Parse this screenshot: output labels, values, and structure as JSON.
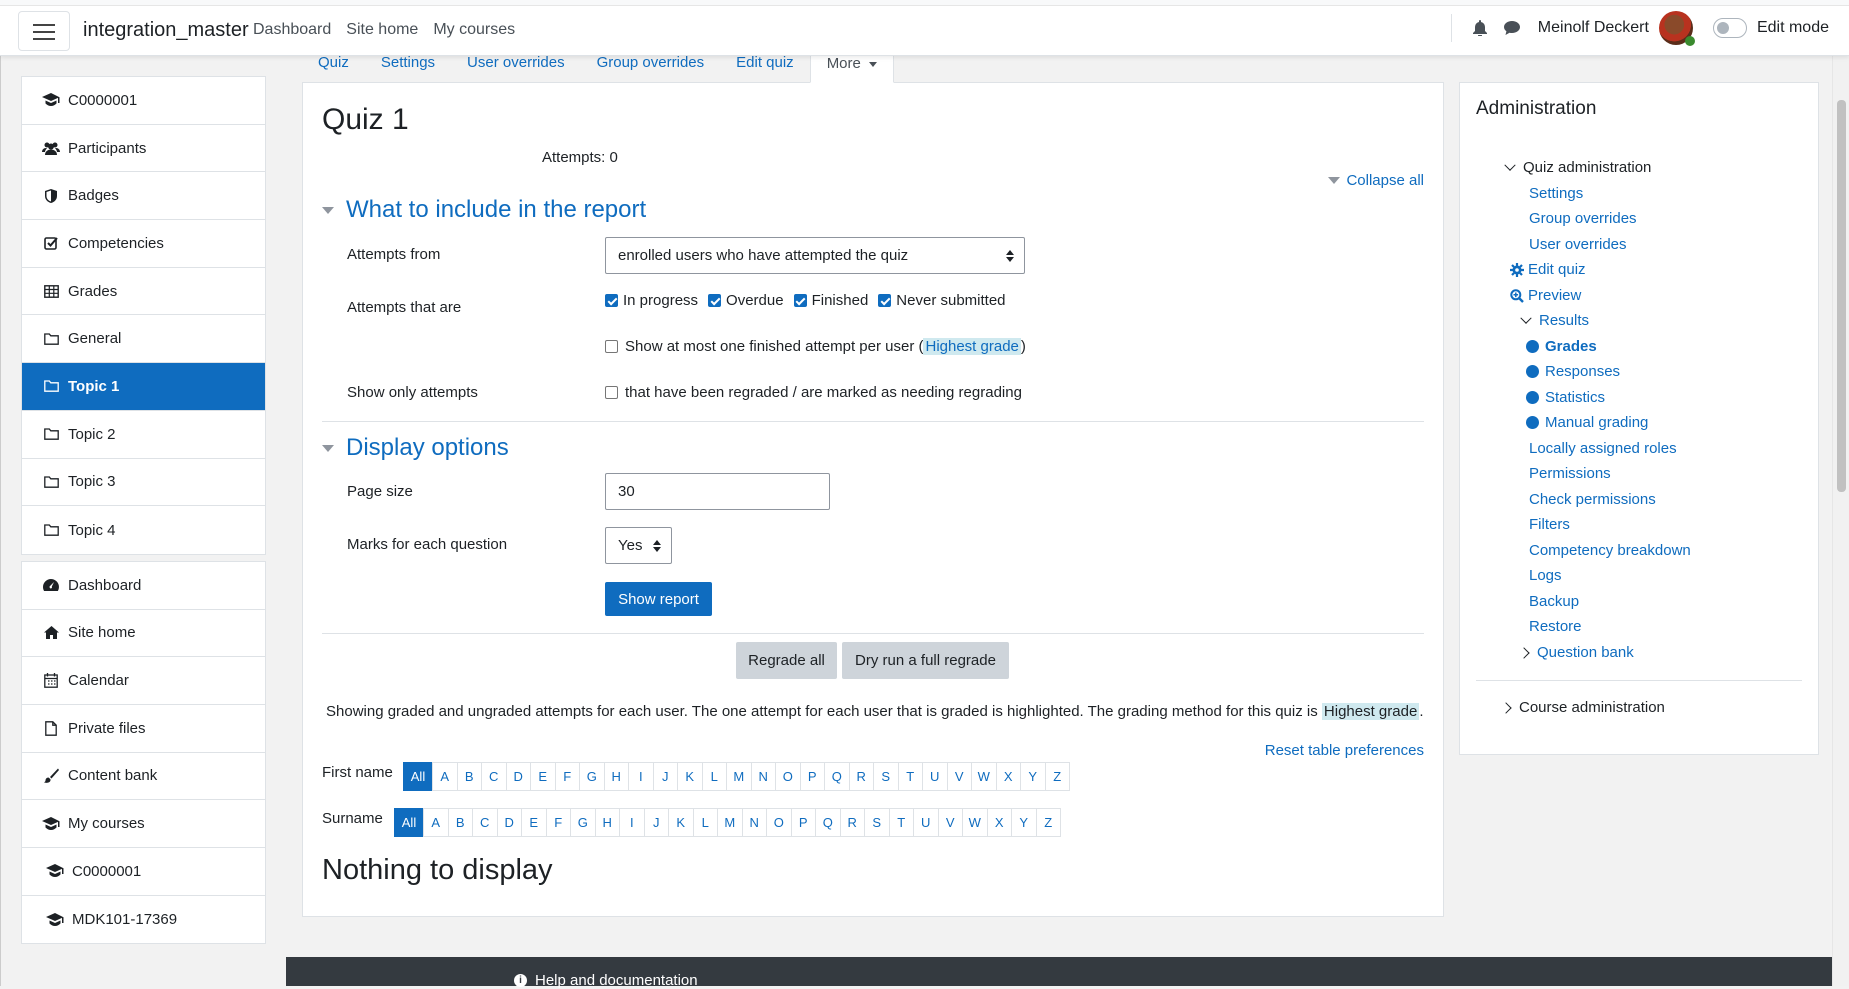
{
  "navbar": {
    "brand": "integration_master",
    "links": [
      "Dashboard",
      "Site home",
      "My courses"
    ],
    "username": "Meinolf Deckert",
    "edit_mode_label": "Edit mode"
  },
  "drawer": {
    "course_items": [
      {
        "label": "C0000001",
        "icon": "graduation-cap-icon"
      },
      {
        "label": "Participants",
        "icon": "users-icon"
      },
      {
        "label": "Badges",
        "icon": "shield-icon"
      },
      {
        "label": "Competencies",
        "icon": "check-square-icon"
      },
      {
        "label": "Grades",
        "icon": "table-icon"
      },
      {
        "label": "General",
        "icon": "folder-icon"
      },
      {
        "label": "Topic 1",
        "icon": "folder-icon",
        "active": true
      },
      {
        "label": "Topic 2",
        "icon": "folder-icon"
      },
      {
        "label": "Topic 3",
        "icon": "folder-icon"
      },
      {
        "label": "Topic 4",
        "icon": "folder-icon"
      }
    ],
    "site_items": [
      {
        "label": "Dashboard",
        "icon": "dashboard-icon"
      },
      {
        "label": "Site home",
        "icon": "home-icon"
      },
      {
        "label": "Calendar",
        "icon": "calendar-icon"
      },
      {
        "label": "Private files",
        "icon": "file-icon"
      },
      {
        "label": "Content bank",
        "icon": "brush-icon"
      },
      {
        "label": "My courses",
        "icon": "graduation-cap-icon"
      },
      {
        "label": "C0000001",
        "icon": "graduation-cap-icon",
        "indent": true
      },
      {
        "label": "MDK101-17369",
        "icon": "graduation-cap-icon",
        "indent": true
      }
    ]
  },
  "tabs": [
    "Quiz",
    "Settings",
    "User overrides",
    "Group overrides",
    "Edit quiz",
    "More"
  ],
  "page": {
    "title": "Quiz 1",
    "attempts": "Attempts: 0",
    "collapse_all": "Collapse all"
  },
  "report_section": {
    "heading": "What to include in the report",
    "attempts_from_label": "Attempts from",
    "attempts_from_value": "enrolled users who have attempted the quiz",
    "attempts_that_are_label": "Attempts that are",
    "states": [
      {
        "label": "In progress",
        "checked": true
      },
      {
        "label": "Overdue",
        "checked": true
      },
      {
        "label": "Finished",
        "checked": true
      },
      {
        "label": "Never submitted",
        "checked": true
      }
    ],
    "one_attempt_text": "Show at most one finished attempt per user (",
    "one_attempt_highlight": "Highest grade",
    "one_attempt_close": ")",
    "show_only_label": "Show only attempts",
    "regraded_text": "that have been regraded / are marked as needing regrading"
  },
  "display_section": {
    "heading": "Display options",
    "page_size_label": "Page size",
    "page_size_value": "30",
    "marks_label": "Marks for each question",
    "marks_value": "Yes",
    "show_report": "Show report"
  },
  "regrade": {
    "regrade_all": "Regrade all",
    "dry_run": "Dry run a full regrade"
  },
  "info": {
    "text": "Showing graded and ungraded attempts for each user. The one attempt for each user that is graded is highlighted. The grading method for this quiz is ",
    "method": "Highest grade",
    "end": "."
  },
  "reset_table": "Reset table preferences",
  "initials": {
    "first_name_label": "First name",
    "surname_label": "Surname",
    "all": "All",
    "letters": [
      "A",
      "B",
      "C",
      "D",
      "E",
      "F",
      "G",
      "H",
      "I",
      "J",
      "K",
      "L",
      "M",
      "N",
      "O",
      "P",
      "Q",
      "R",
      "S",
      "T",
      "U",
      "V",
      "W",
      "X",
      "Y",
      "Z"
    ]
  },
  "nothing": "Nothing to display",
  "admin": {
    "title": "Administration",
    "quiz_admin": "Quiz administration",
    "settings": "Settings",
    "group_overrides": "Group overrides",
    "user_overrides": "User overrides",
    "edit_quiz": "Edit quiz",
    "preview": "Preview",
    "results": "Results",
    "grades": "Grades",
    "responses": "Responses",
    "statistics": "Statistics",
    "manual_grading": "Manual grading",
    "locally_assigned_roles": "Locally assigned roles",
    "permissions": "Permissions",
    "check_permissions": "Check permissions",
    "filters": "Filters",
    "competency_breakdown": "Competency breakdown",
    "logs": "Logs",
    "backup": "Backup",
    "restore": "Restore",
    "question_bank": "Question bank",
    "course_admin": "Course administration"
  },
  "footer": {
    "help": "Help and documentation"
  },
  "colors": {
    "accent": "#0f6cbf",
    "footer": "#343a40",
    "highlight": "#cfe9ef"
  }
}
